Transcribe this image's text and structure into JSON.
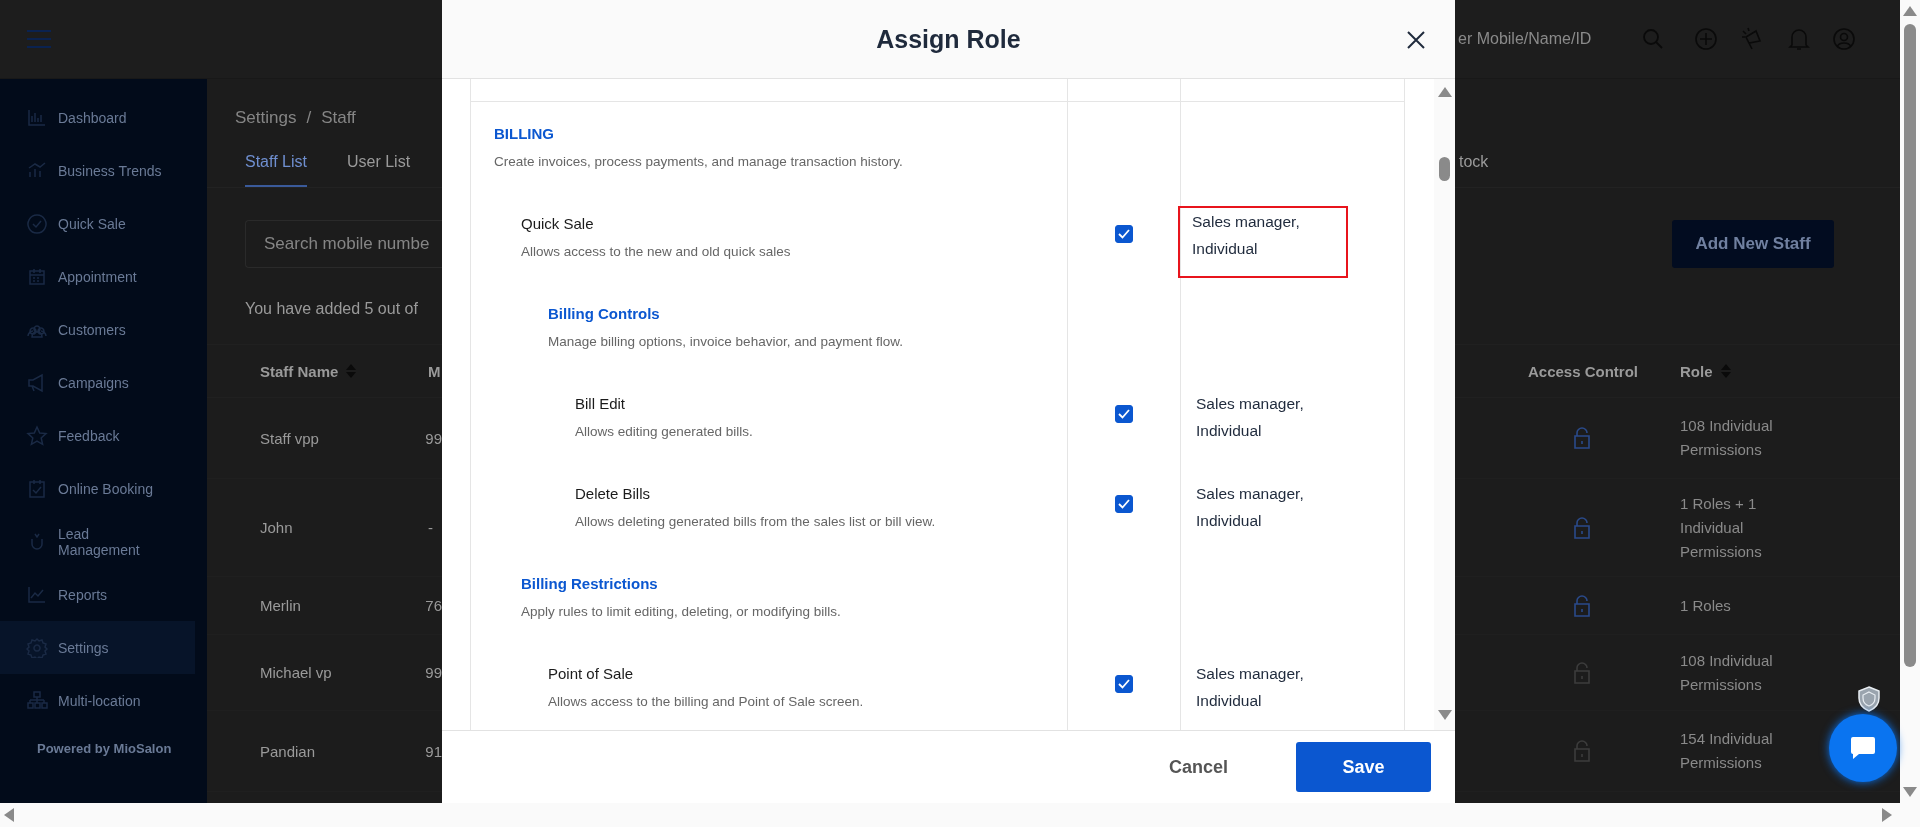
{
  "app_header": {
    "search": {
      "placeholder": "er Mobile/Name/ID"
    }
  },
  "sidebar": {
    "items": [
      {
        "label": "Dashboard",
        "selected": false
      },
      {
        "label": "Business Trends",
        "selected": false
      },
      {
        "label": "Quick Sale",
        "selected": false
      },
      {
        "label": "Appointment",
        "selected": false
      },
      {
        "label": "Customers",
        "selected": false
      },
      {
        "label": "Campaigns",
        "selected": false
      },
      {
        "label": "Feedback",
        "selected": false
      },
      {
        "label": "Online Booking",
        "selected": false
      },
      {
        "label": "Lead Management",
        "selected": false
      },
      {
        "label": "Reports",
        "selected": false
      },
      {
        "label": "Settings",
        "selected": true
      },
      {
        "label": "Multi-location",
        "selected": false
      }
    ],
    "footer": "Powered by MioSalon"
  },
  "page": {
    "breadcrumb": [
      "Settings",
      "Staff"
    ],
    "breadcrumb_separator": "/",
    "tabs": [
      {
        "label": "Staff List",
        "selected": true
      },
      {
        "label": "User List",
        "selected": false
      },
      {
        "label": "tock",
        "selected": false
      }
    ],
    "search": {
      "placeholder": "Search mobile numbe"
    },
    "add_button": "Add New Staff",
    "summary": "You have added 5 out of",
    "table": {
      "columns": [
        {
          "label": "Staff Name",
          "sortable": true
        },
        {
          "label": "M",
          "sortable": false
        },
        {
          "label": "Access Control",
          "sortable": false
        },
        {
          "label": "Role",
          "sortable": true
        }
      ],
      "rows": [
        {
          "name": "Staff vpp",
          "column_2": "99",
          "access_enabled": true,
          "role": "108 Individual Permissions"
        },
        {
          "name": "John",
          "column_2": "-",
          "access_enabled": true,
          "role": "1 Roles + 1 Individual Permissions"
        },
        {
          "name": "Merlin",
          "column_2": "76",
          "access_enabled": true,
          "role": "1 Roles"
        },
        {
          "name": "Michael vp",
          "column_2": "99",
          "access_enabled": false,
          "role": "108 Individual Permissions"
        },
        {
          "name": "Pandian",
          "column_2": "91",
          "access_enabled": false,
          "role": "154 Individual Permissions"
        }
      ]
    }
  },
  "modal": {
    "title": "Assign Role",
    "permissions": [
      {
        "kind": "group",
        "title": "BILLING",
        "description": "Create invoices, process payments, and manage transaction history.",
        "children": [
          {
            "kind": "permission",
            "title": "Quick Sale",
            "description": "Allows access to the new and old quick sales",
            "checked": true,
            "roles": "Sales manager, Individual",
            "highlighted": true,
            "children": [
              {
                "kind": "group",
                "title": "Billing Controls",
                "description": "Manage billing options, invoice behavior, and payment flow.",
                "children": [
                  {
                    "kind": "permission",
                    "title": "Bill Edit",
                    "description": "Allows editing generated bills.",
                    "checked": true,
                    "roles": "Sales manager, Individual",
                    "highlighted": false
                  },
                  {
                    "kind": "permission",
                    "title": "Delete Bills",
                    "description": "Allows deleting generated bills from the sales list or bill view.",
                    "checked": true,
                    "roles": "Sales manager, Individual",
                    "highlighted": false
                  }
                ]
              }
            ]
          },
          {
            "kind": "group",
            "title": "Billing Restrictions",
            "description": "Apply rules to limit editing, deleting, or modifying bills.",
            "children": [
              {
                "kind": "permission",
                "title": "Point of Sale",
                "description": "Allows access to the billing and Point of Sale screen.",
                "checked": true,
                "roles": "Sales manager, Individual",
                "highlighted": false
              }
            ]
          }
        ]
      }
    ],
    "buttons": {
      "cancel": "Cancel",
      "save": "Save"
    }
  }
}
